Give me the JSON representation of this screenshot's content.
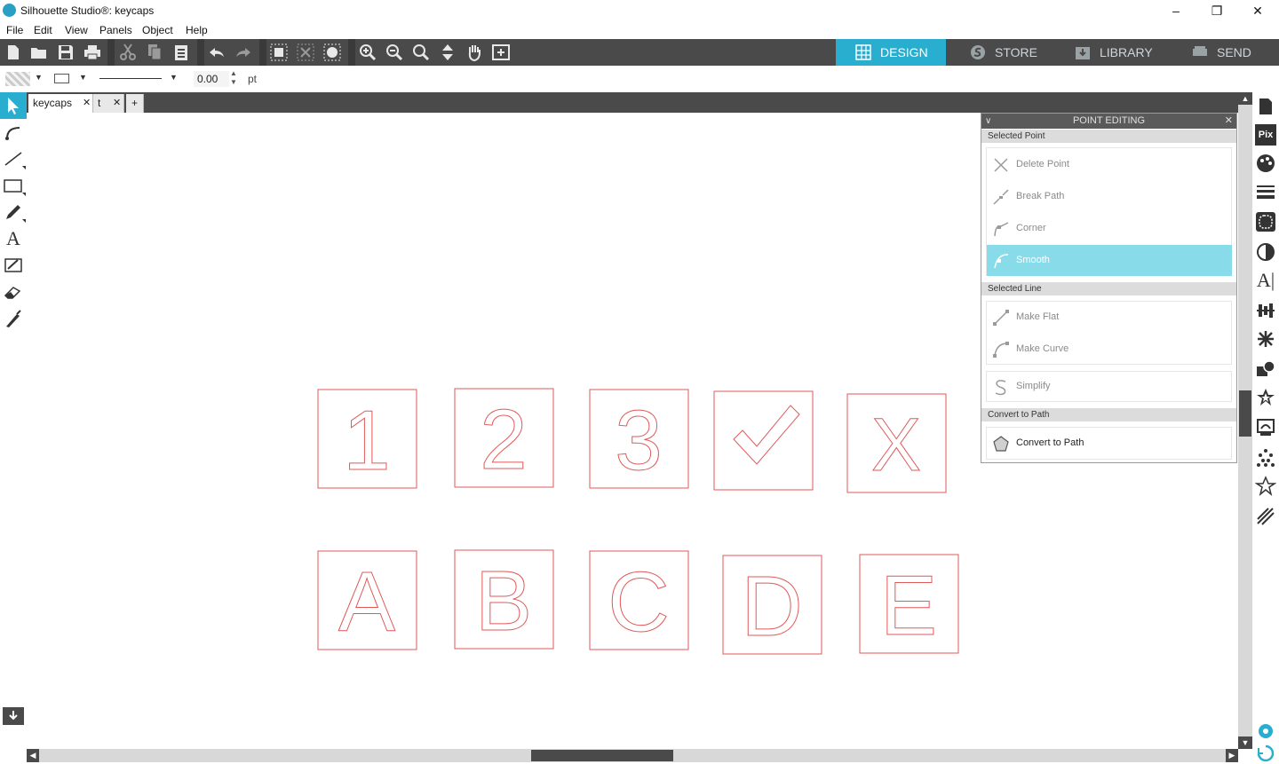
{
  "app": {
    "title": "Silhouette Studio®: keycaps"
  },
  "menu": [
    "File",
    "Edit",
    "View",
    "Panels",
    "Object",
    "Help"
  ],
  "nav_tabs": [
    {
      "label": "DESIGN",
      "icon": "grid-icon",
      "active": true
    },
    {
      "label": "STORE",
      "icon": "silhouette-s-icon",
      "active": false
    },
    {
      "label": "LIBRARY",
      "icon": "download-icon",
      "active": false
    },
    {
      "label": "SEND",
      "icon": "cutter-icon",
      "active": false
    }
  ],
  "properties": {
    "line_width": "0.00",
    "unit": "pt"
  },
  "document_tabs": [
    {
      "label": "keycaps",
      "active": true
    },
    {
      "label": "t",
      "active": false
    }
  ],
  "add_tab": "+",
  "panel": {
    "title": "POINT EDITING",
    "section_selected_point": "Selected Point",
    "delete_point": "Delete Point",
    "break_path": "Break Path",
    "corner": "Corner",
    "smooth": "Smooth",
    "section_selected_line": "Selected Line",
    "make_flat": "Make Flat",
    "make_curve": "Make Curve",
    "simplify": "Simplify",
    "section_convert": "Convert to Path",
    "convert_to_path": "Convert to Path"
  },
  "canvas": {
    "keycaps_row1": [
      "1",
      "2",
      "3",
      "✓",
      "X"
    ],
    "keycaps_row2": [
      "A",
      "B",
      "C",
      "D",
      "E"
    ],
    "outline_color": "#e05a5a"
  },
  "colors": {
    "accent": "#2aaed0",
    "toolbar_bg": "#4a4a4a",
    "smooth_highlight": "#88dcea"
  }
}
